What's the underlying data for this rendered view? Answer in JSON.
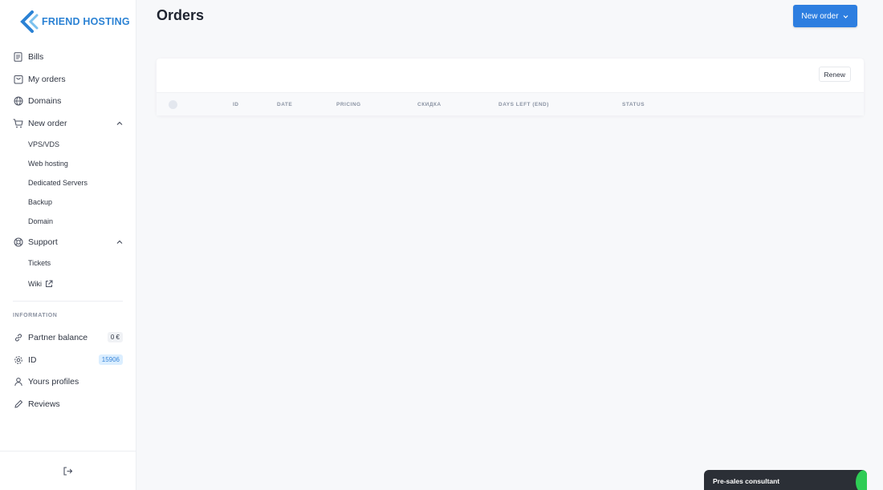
{
  "brand": {
    "name": "FRIEND HOSTING",
    "color": "#2b82d4"
  },
  "sidebar": {
    "items": [
      {
        "label": "Bills",
        "icon": "document-icon"
      },
      {
        "label": "My orders",
        "icon": "cart-box-icon"
      },
      {
        "label": "Domains",
        "icon": "globe-icon"
      },
      {
        "label": "New order",
        "icon": "cart-icon",
        "expanded": true,
        "children": [
          "VPS/VDS",
          "Web hosting",
          "Dedicated Servers",
          "Backup",
          "Domain"
        ]
      },
      {
        "label": "Support",
        "icon": "lifebuoy-icon",
        "expanded": true,
        "children": [
          "Tickets",
          "Wiki"
        ]
      }
    ],
    "information_label": "INFORMATION",
    "info": [
      {
        "label": "Partner balance",
        "icon": "link-icon",
        "badge": "0 €"
      },
      {
        "label": "ID",
        "icon": "gear-icon",
        "badge": "15906"
      },
      {
        "label": "Yours profiles",
        "icon": "user-icon"
      },
      {
        "label": "Reviews",
        "icon": "pencil-icon"
      }
    ]
  },
  "header": {
    "title": "Orders",
    "new_order_label": "New order"
  },
  "accent": "#2d7ee0",
  "toolbar": {
    "renew_label": "Renew"
  },
  "table": {
    "columns": [
      "ID",
      "DATE",
      "PRICING",
      "СКИДКА",
      "DAYS LEFT (END)",
      "STATUS"
    ]
  },
  "chat": {
    "label": "Pre-sales consultant"
  }
}
